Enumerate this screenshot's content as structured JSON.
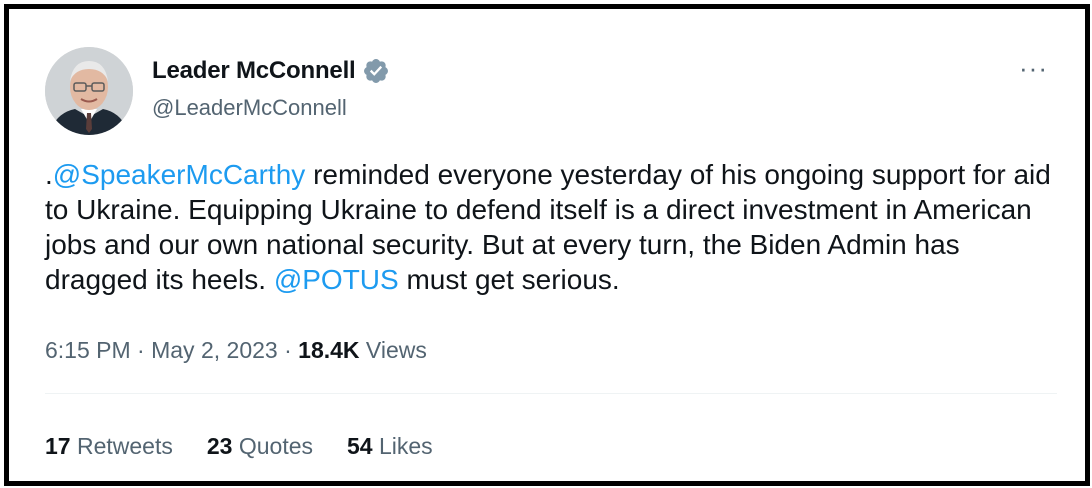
{
  "author": {
    "name": "Leader McConnell",
    "handle": "@LeaderMcConnell",
    "verified": true,
    "avatar_icon": "profile-photo"
  },
  "more_label": "···",
  "tweet": {
    "prefix": ".",
    "mention1": "@SpeakerMcCarthy",
    "text1": " reminded everyone yesterday of his ongoing support for aid to Ukraine. Equipping Ukraine to defend itself is a direct investment in American jobs and our own national security. But at every turn, the Biden Admin has dragged its heels. ",
    "mention2": "@POTUS",
    "text2": " must get serious."
  },
  "meta": {
    "time": "6:15 PM",
    "sep1": " · ",
    "date": "May 2, 2023",
    "sep2": " · ",
    "views_count": "18.4K",
    "views_label": " Views"
  },
  "stats": {
    "retweets_count": "17",
    "retweets_label": " Retweets",
    "quotes_count": "23",
    "quotes_label": " Quotes",
    "likes_count": "54",
    "likes_label": " Likes"
  },
  "colors": {
    "link": "#1d9bf0",
    "secondary": "#536471",
    "text": "#0f1419"
  }
}
